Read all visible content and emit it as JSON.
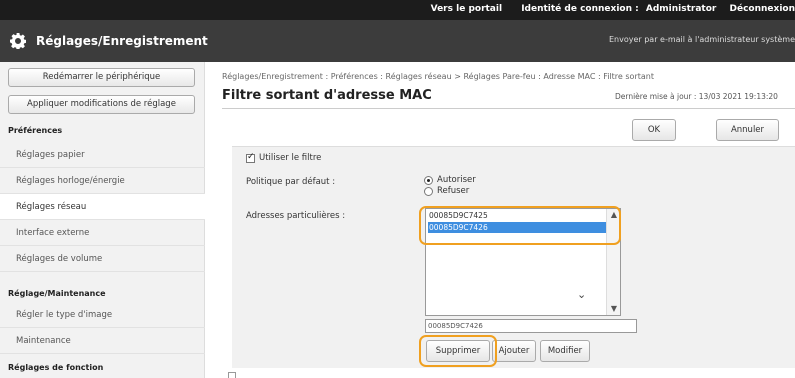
{
  "topbar": {
    "portal_link": "Vers le portail",
    "login_label": "Identité de connexion :",
    "user": "Administrator",
    "logout_link": "Déconnexion"
  },
  "header": {
    "title": "Réglages/Enregistrement",
    "email_link": "Envoyer par e-mail à l'administrateur système"
  },
  "sidebar": {
    "restart_button": "Redémarrer le périphérique",
    "apply_button": "Appliquer modifications de réglage",
    "sections": [
      {
        "heading": "Préférences",
        "items": [
          "Réglages papier",
          "Réglages horloge/énergie",
          "Réglages réseau",
          "Interface externe",
          "Réglages de volume"
        ]
      },
      {
        "heading": "Réglage/Maintenance",
        "items": [
          "Régler le type d'image",
          "Maintenance"
        ]
      },
      {
        "heading": "Réglages de fonction",
        "items": []
      }
    ],
    "active_item": "Réglages réseau"
  },
  "breadcrumb": "Réglages/Enregistrement : Préférences : Réglages réseau > Réglages Pare-feu : Adresse MAC : Filtre sortant",
  "page_title": "Filtre sortant d'adresse MAC",
  "last_update": "Dernière mise à jour : 13/03 2021 19:13:20",
  "buttons": {
    "ok": "OK",
    "cancel": "Annuler",
    "delete": "Supprimer",
    "add": "Ajouter",
    "edit": "Modifier"
  },
  "form": {
    "use_filter_label": "Utiliser le filtre",
    "use_filter_checked": true,
    "default_policy_label": "Politique par défaut :",
    "policy_options": [
      "Autoriser",
      "Refuser"
    ],
    "policy_selected": "Autoriser",
    "addresses_label": "Adresses particulières :",
    "addresses": [
      "00085D9C7425",
      "00085D9C7426"
    ],
    "selected_address": "00085D9C7426",
    "address_input_value": "00085D9C7426"
  },
  "colors": {
    "highlight": "#f0a020",
    "selection": "#3e8ee0",
    "header_bg": "#3c3c3c",
    "topbar_bg": "#1c1c1c"
  }
}
